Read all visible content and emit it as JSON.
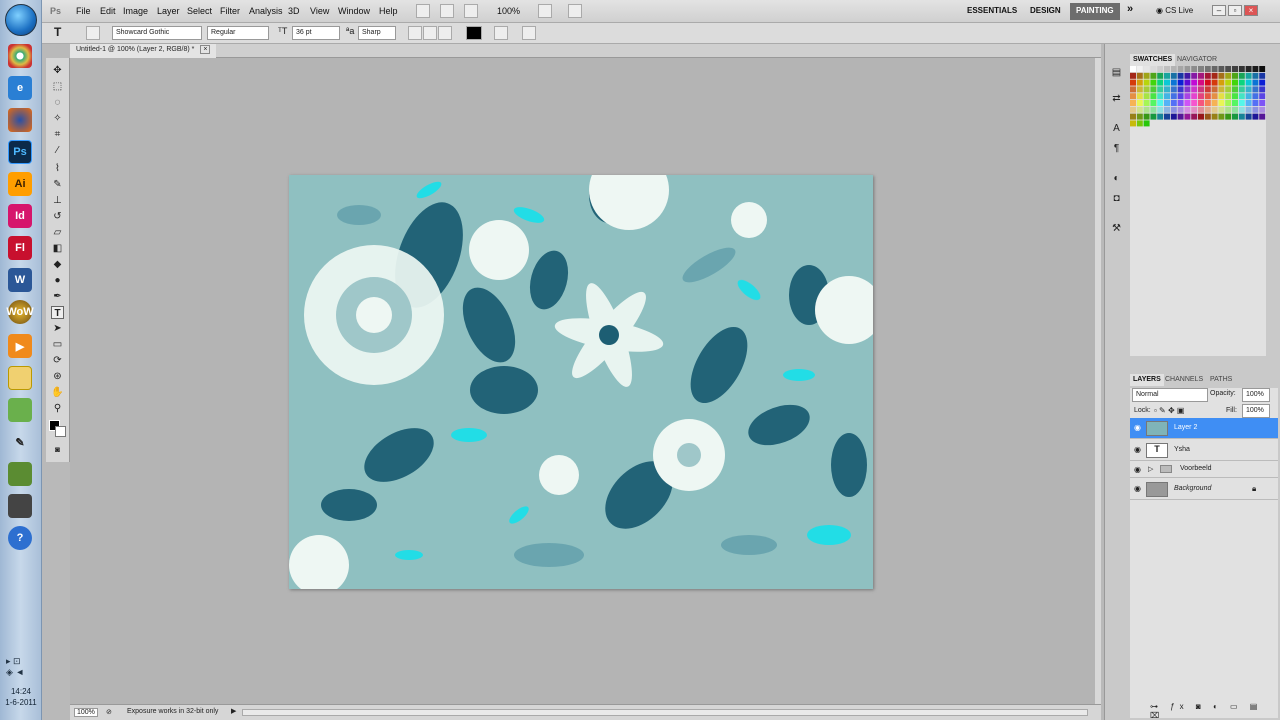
{
  "taskbar": {
    "apps": [
      "Chrome",
      "IE",
      "Firefox",
      "Ps",
      "Ai",
      "Id",
      "Fl",
      "W",
      "WoW",
      "Media",
      "Folder",
      "Paint",
      "Brush",
      "Minecraft",
      "Installer",
      "?"
    ],
    "time": "14:24",
    "date": "1-6-2011"
  },
  "menubar": {
    "app": "Ps",
    "items": [
      "File",
      "Edit",
      "Image",
      "Layer",
      "Select",
      "Filter",
      "Analysis",
      "3D",
      "View",
      "Window",
      "Help"
    ],
    "zoom": "100%",
    "workspaces": [
      "ESSENTIALS",
      "DESIGN",
      "PAINTING"
    ],
    "cslive": "CS Live"
  },
  "options": {
    "font_family": "Showcard Gothic",
    "font_style": "Regular",
    "font_size": "36 pt",
    "antialias": "Sharp"
  },
  "document": {
    "tab_title": "Untitled-1 @ 100% (Layer 2, RGB/8) *"
  },
  "status": {
    "zoom": "100%",
    "message": "Exposure works in 32-bit only"
  },
  "panels": {
    "swatches_tab": "SWATCHES",
    "navigator_tab": "NAVIGATOR",
    "layers_tab": "LAYERS",
    "channels_tab": "CHANNELS",
    "paths_tab": "PATHS",
    "blend_mode": "Normal",
    "opacity_label": "Opacity:",
    "opacity": "100%",
    "lock_label": "Lock:",
    "fill_label": "Fill:",
    "fill": "100%",
    "layers": [
      {
        "name": "Layer 2",
        "selected": true
      },
      {
        "name": "Ysha",
        "selected": false
      },
      {
        "name": "Voorbeeld",
        "selected": false
      },
      {
        "name": "Background",
        "selected": false
      }
    ]
  },
  "colors": {
    "canvas_bg": "#8fc0c1",
    "teal_dark": "#1d5e73",
    "cyan": "#22dde6",
    "flower_white": "#eef7f3",
    "selection_blue": "#3f8ef4"
  }
}
